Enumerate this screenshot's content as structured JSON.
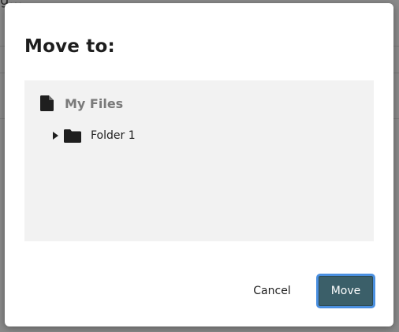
{
  "background": {
    "partial_text": "g..."
  },
  "dialog": {
    "title": "Move to:",
    "tree": {
      "root": {
        "label": "My Files",
        "icon": "file-icon"
      },
      "nodes": [
        {
          "label": "Folder 1",
          "icon": "folder-icon",
          "expander_icon": "caret-right-icon",
          "expanded": false
        }
      ]
    },
    "buttons": {
      "cancel_label": "Cancel",
      "move_label": "Move"
    }
  },
  "colors": {
    "primary_button": "#3b5f69",
    "focus_ring": "#4a8fe0",
    "panel_background": "#f2f2f2"
  }
}
